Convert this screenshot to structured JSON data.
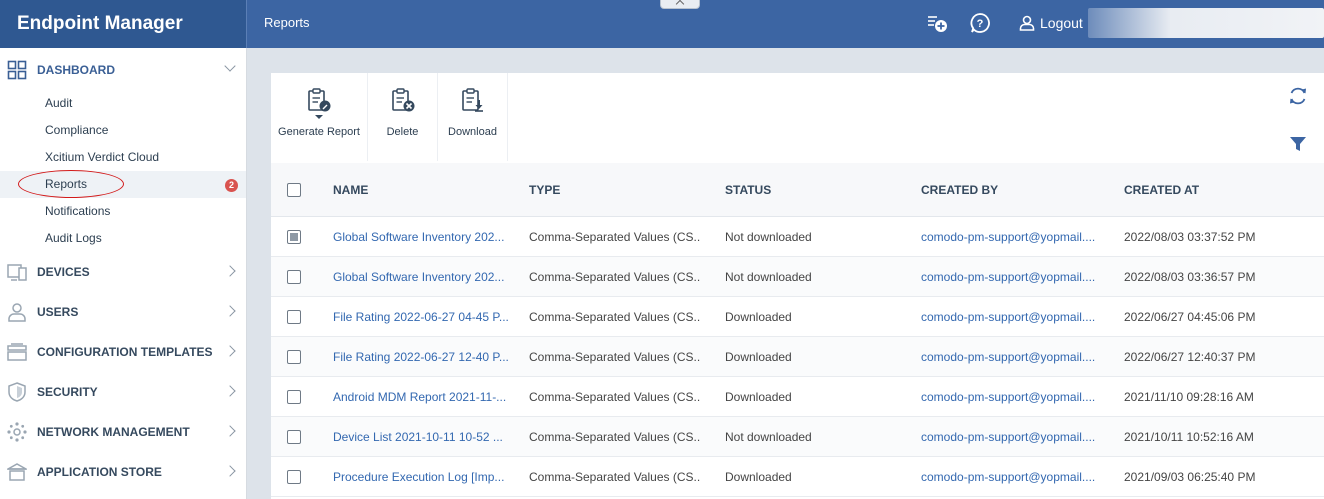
{
  "app": {
    "brand": "Endpoint Manager",
    "breadcrumb": "Reports",
    "logout_label": "Logout"
  },
  "sidebar": {
    "dashboard": {
      "label": "DASHBOARD",
      "icon": "grid-icon",
      "items": [
        {
          "label": "Audit"
        },
        {
          "label": "Compliance"
        },
        {
          "label": "Xcitium Verdict Cloud"
        },
        {
          "label": "Reports",
          "badge": "2",
          "active": true
        },
        {
          "label": "Notifications"
        },
        {
          "label": "Audit Logs"
        }
      ]
    },
    "sections": [
      {
        "label": "DEVICES",
        "icon": "devices-icon"
      },
      {
        "label": "USERS",
        "icon": "user-icon"
      },
      {
        "label": "CONFIGURATION TEMPLATES",
        "icon": "templates-icon"
      },
      {
        "label": "SECURITY",
        "icon": "shield-icon"
      },
      {
        "label": "NETWORK MANAGEMENT",
        "icon": "network-icon"
      },
      {
        "label": "APPLICATION STORE",
        "icon": "store-icon"
      }
    ]
  },
  "toolbar": {
    "generate_label": "Generate Report",
    "delete_label": "Delete",
    "download_label": "Download"
  },
  "table": {
    "headers": {
      "name": "NAME",
      "type": "TYPE",
      "status": "STATUS",
      "created_by": "CREATED BY",
      "created_at": "CREATED AT"
    },
    "rows": [
      {
        "name": "Global Software Inventory 202...",
        "type": "Comma-Separated Values (CS...",
        "status": "Not downloaded",
        "created_by": "comodo-pm-support@yopmail....",
        "created_at": "2022/08/03 03:37:52 PM",
        "checked": "partial"
      },
      {
        "name": "Global Software Inventory 202...",
        "type": "Comma-Separated Values (CS...",
        "status": "Not downloaded",
        "created_by": "comodo-pm-support@yopmail....",
        "created_at": "2022/08/03 03:36:57 PM"
      },
      {
        "name": "File Rating 2022-06-27 04-45 P...",
        "type": "Comma-Separated Values (CS...",
        "status": "Downloaded",
        "created_by": "comodo-pm-support@yopmail....",
        "created_at": "2022/06/27 04:45:06 PM"
      },
      {
        "name": "File Rating 2022-06-27 12-40 P...",
        "type": "Comma-Separated Values (CS...",
        "status": "Downloaded",
        "created_by": "comodo-pm-support@yopmail....",
        "created_at": "2022/06/27 12:40:37 PM"
      },
      {
        "name": "Android MDM Report 2021-11-...",
        "type": "Comma-Separated Values (CS...",
        "status": "Downloaded",
        "created_by": "comodo-pm-support@yopmail....",
        "created_at": "2021/11/10 09:28:16 AM"
      },
      {
        "name": "Device List 2021-10-11 10-52 ...",
        "type": "Comma-Separated Values (CS...",
        "status": "Not downloaded",
        "created_by": "comodo-pm-support@yopmail....",
        "created_at": "2021/10/11 10:52:16 AM"
      },
      {
        "name": "Procedure Execution Log [Imp...",
        "type": "Comma-Separated Values (CS...",
        "status": "Downloaded",
        "created_by": "comodo-pm-support@yopmail....",
        "created_at": "2021/09/03 06:25:40 PM"
      }
    ]
  },
  "colors": {
    "topbar": "#3c65a3",
    "brand_bg": "#2f5891",
    "link": "#3368b0",
    "badge": "#d9534f",
    "annotation": "#d21a1a"
  }
}
